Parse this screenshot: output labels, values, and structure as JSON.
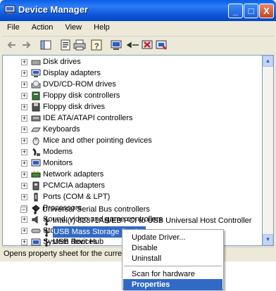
{
  "window": {
    "title": "Device Manager",
    "controls": {
      "minimize": "_",
      "maximize": "□",
      "close": "X"
    }
  },
  "menubar": {
    "items": [
      "File",
      "Action",
      "View",
      "Help"
    ]
  },
  "toolbar": {
    "buttons": [
      "back-icon",
      "forward-icon",
      "show-hide-console-tree-icon",
      "properties-icon",
      "print-icon",
      "help-icon",
      "scan-hardware-icon",
      "update-driver-icon",
      "uninstall-icon",
      "disable-icon"
    ]
  },
  "tree": {
    "items": [
      {
        "label": "Disk drives",
        "icon": "disk-drive-icon",
        "expander": "+"
      },
      {
        "label": "Display adapters",
        "icon": "display-adapter-icon",
        "expander": "+"
      },
      {
        "label": "DVD/CD-ROM drives",
        "icon": "dvd-drive-icon",
        "expander": "+"
      },
      {
        "label": "Floppy disk controllers",
        "icon": "floppy-controller-icon",
        "expander": "+"
      },
      {
        "label": "Floppy disk drives",
        "icon": "floppy-drive-icon",
        "expander": "+"
      },
      {
        "label": "IDE ATA/ATAPI controllers",
        "icon": "ide-controller-icon",
        "expander": "+"
      },
      {
        "label": "Keyboards",
        "icon": "keyboard-icon",
        "expander": "+"
      },
      {
        "label": "Mice and other pointing devices",
        "icon": "mouse-icon",
        "expander": "+"
      },
      {
        "label": "Modems",
        "icon": "modem-icon",
        "expander": "+"
      },
      {
        "label": "Monitors",
        "icon": "monitor-icon",
        "expander": "+"
      },
      {
        "label": "Network adapters",
        "icon": "network-adapter-icon",
        "expander": "+"
      },
      {
        "label": "PCMCIA adapters",
        "icon": "pcmcia-icon",
        "expander": "+"
      },
      {
        "label": "Ports (COM & LPT)",
        "icon": "port-icon",
        "expander": "+"
      },
      {
        "label": "Processors",
        "icon": "processor-icon",
        "expander": "+"
      },
      {
        "label": "Sound, video and game controllers",
        "icon": "sound-icon",
        "expander": "+"
      },
      {
        "label": "Storage volumes",
        "icon": "storage-volume-icon",
        "expander": "+"
      },
      {
        "label": "System devices",
        "icon": "system-device-icon",
        "expander": "+"
      },
      {
        "label": "Universal Serial Bus controllers",
        "icon": "usb-icon",
        "expander": "−"
      }
    ],
    "children": [
      {
        "label": "Intel(r) 82371AB/EB PCI to USB Universal Host Controller",
        "icon": "usb-icon"
      },
      {
        "label": "USB Mass Storage Device",
        "icon": "usb-icon",
        "selected": true
      },
      {
        "label": "USB Root Hub",
        "icon": "usb-icon"
      }
    ]
  },
  "scrollbar": {
    "up": "▲",
    "down": "▼"
  },
  "statusbar": {
    "text": "Opens property sheet for the current sele"
  },
  "context_menu": {
    "items": [
      "Update Driver...",
      "Disable",
      "Uninstall",
      "Scan for hardware changes",
      "Properties"
    ],
    "active": "Properties"
  }
}
